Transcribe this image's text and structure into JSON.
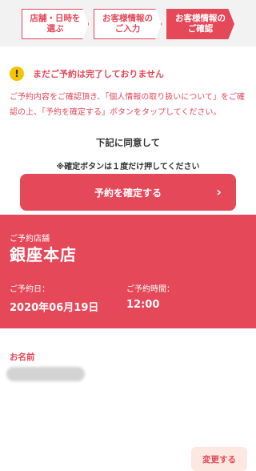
{
  "steps": [
    {
      "label": "店舗・日時を\n選ぶ"
    },
    {
      "label": "お客様情報の\nご入力"
    },
    {
      "label": "お客様情報の\nご確認"
    }
  ],
  "warning": {
    "icon": "!",
    "title": "まだご予約は完了しておりません",
    "body": "ご予約内容をご確認頂き、「個人情報の取り扱いについて」をご確認の上、「予約を確定する」ボタンをタップしてください。"
  },
  "agreement": {
    "heading": "下記に同意して",
    "note": "※確定ボタンは１度だけ押してください",
    "confirm_label": "予約を確定する",
    "confirm_chevron": "›"
  },
  "reservation": {
    "shop_label": "ご予約店舗",
    "shop_name": "銀座本店",
    "change_label": "変更する",
    "date_label": "ご予約日：",
    "date_value": "2020年06月19日",
    "time_label": "ご予約時間：",
    "time_value": "12:00"
  },
  "customer": {
    "name_label": "お名前"
  },
  "colors": {
    "accent": "#e54859",
    "header_bg": "#f2f2f2",
    "warning_icon": "#f5c400",
    "change_button_bg": "#fce8e1"
  }
}
